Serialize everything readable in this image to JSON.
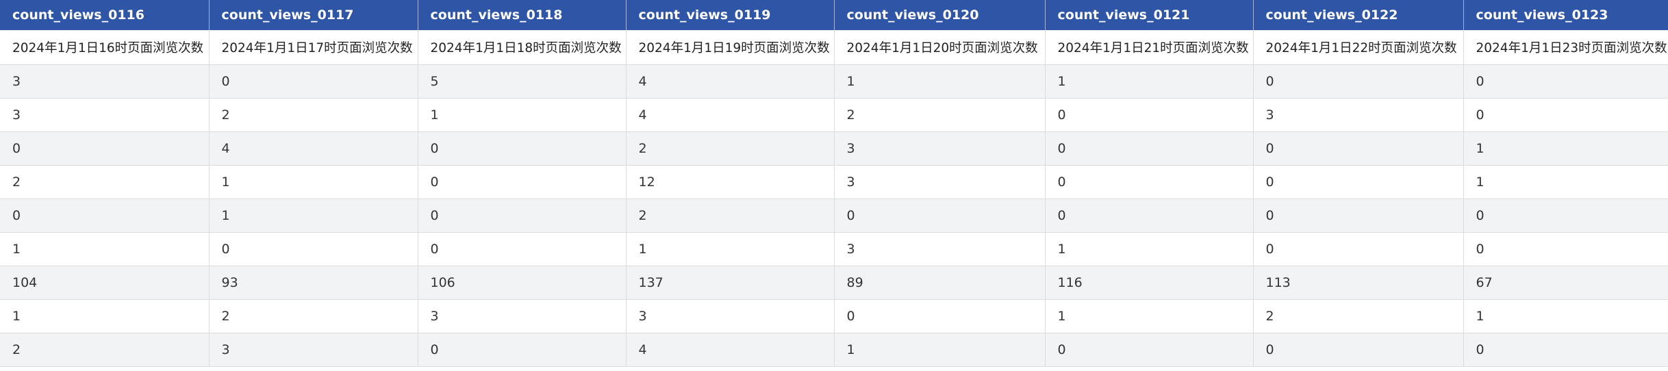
{
  "columns": [
    "count_views_0116",
    "count_views_0117",
    "count_views_0118",
    "count_views_0119",
    "count_views_0120",
    "count_views_0121",
    "count_views_0122",
    "count_views_0123"
  ],
  "descriptions": [
    "2024年1月1日16时页面浏览次数",
    "2024年1月1日17时页面浏览次数",
    "2024年1月1日18时页面浏览次数",
    "2024年1月1日19时页面浏览次数",
    "2024年1月1日20时页面浏览次数",
    "2024年1月1日21时页面浏览次数",
    "2024年1月1日22时页面浏览次数",
    "2024年1月1日23时页面浏览次数"
  ],
  "rows": [
    [
      "3",
      "0",
      "5",
      "4",
      "1",
      "1",
      "0",
      "0"
    ],
    [
      "3",
      "2",
      "1",
      "4",
      "2",
      "0",
      "3",
      "0"
    ],
    [
      "0",
      "4",
      "0",
      "2",
      "3",
      "0",
      "0",
      "1"
    ],
    [
      "2",
      "1",
      "0",
      "12",
      "3",
      "0",
      "0",
      "1"
    ],
    [
      "0",
      "1",
      "0",
      "2",
      "0",
      "0",
      "0",
      "0"
    ],
    [
      "1",
      "0",
      "0",
      "1",
      "3",
      "1",
      "0",
      "0"
    ],
    [
      "104",
      "93",
      "106",
      "137",
      "89",
      "116",
      "113",
      "67"
    ],
    [
      "1",
      "2",
      "3",
      "3",
      "0",
      "1",
      "2",
      "1"
    ],
    [
      "2",
      "3",
      "0",
      "4",
      "1",
      "0",
      "0",
      "0"
    ]
  ]
}
